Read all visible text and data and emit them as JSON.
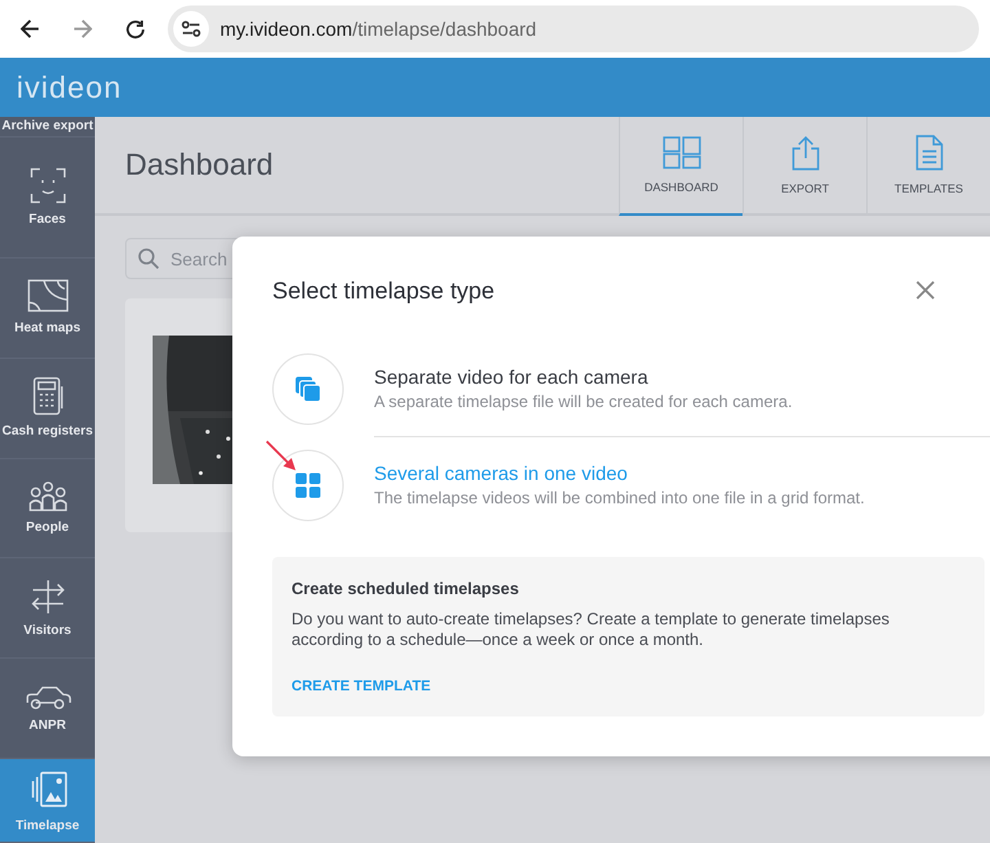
{
  "browser": {
    "url_host": "my.ivideon.com",
    "url_path": "/timelapse/dashboard",
    "forward_disabled": true
  },
  "app": {
    "logo": "ivideon"
  },
  "sidebar": {
    "items": [
      {
        "label": "Archive export",
        "kind": "none",
        "selected": false
      },
      {
        "label": "Faces",
        "kind": "faces",
        "selected": false
      },
      {
        "label": "Heat maps",
        "kind": "heatmap",
        "selected": false
      },
      {
        "label": "Cash registers",
        "kind": "register",
        "selected": false
      },
      {
        "label": "People",
        "kind": "people",
        "selected": false
      },
      {
        "label": "Visitors",
        "kind": "visitors",
        "selected": false
      },
      {
        "label": "ANPR",
        "kind": "car",
        "selected": false
      },
      {
        "label": "Timelapse",
        "kind": "timelapse",
        "selected": true
      }
    ]
  },
  "page": {
    "title": "Dashboard",
    "tabs": [
      {
        "label": "DASHBOARD",
        "kind": "dashboard",
        "selected": true
      },
      {
        "label": "EXPORT",
        "kind": "export",
        "selected": false
      },
      {
        "label": "TEMPLATES",
        "kind": "templates",
        "selected": false
      }
    ],
    "search": {
      "placeholder": "Search"
    }
  },
  "dialog": {
    "title": "Select timelapse type",
    "options": [
      {
        "title": "Separate video for each camera",
        "description": "A separate timelapse file will be created for each camera.",
        "kind": "separate",
        "selected": false
      },
      {
        "title": "Several cameras in one video",
        "description": "The timelapse videos will be combined into one file in a grid format.",
        "kind": "grid",
        "selected": true
      }
    ],
    "scheduled": {
      "title": "Create scheduled timelapses",
      "text": "Do you want to auto-create timelapses? Create a template to generate timelapses according to a schedule—once a week or once a month.",
      "link": "CREATE TEMPLATE"
    }
  }
}
